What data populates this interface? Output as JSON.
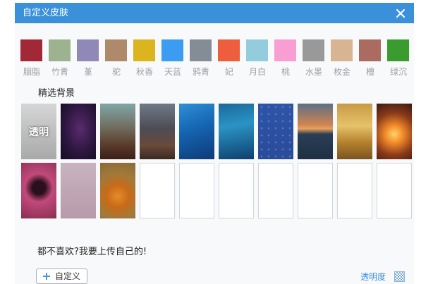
{
  "window": {
    "title": "自定义皮肤",
    "close_icon": "close-icon"
  },
  "colors": [
    {
      "label": "胭脂",
      "color": "#a02837"
    },
    {
      "label": "竹青",
      "color": "#9db38f"
    },
    {
      "label": "堇",
      "color": "#9089b8"
    },
    {
      "label": "驼",
      "color": "#ae8a6a"
    },
    {
      "label": "秋香",
      "color": "#dbb41e"
    },
    {
      "label": "天蓝",
      "color": "#3b9cf2"
    },
    {
      "label": "鸦青",
      "color": "#848c95"
    },
    {
      "label": "妃",
      "color": "#ee5d3c"
    },
    {
      "label": "月白",
      "color": "#92ccdd"
    },
    {
      "label": "桃",
      "color": "#f99ed2"
    },
    {
      "label": "水墨",
      "color": "#999999"
    },
    {
      "label": "枚金",
      "color": "#d7b593"
    },
    {
      "label": "檀",
      "color": "#ac6b60"
    },
    {
      "label": "绿沉",
      "color": "#3a9c2e"
    }
  ],
  "backgrounds": {
    "title": "精选背景",
    "transparent_label": "透明",
    "items": [
      {
        "name": "transparent"
      },
      {
        "name": "purple-blur"
      },
      {
        "name": "teal-brown-blur"
      },
      {
        "name": "grey-orange-blur"
      },
      {
        "name": "deep-blue-gradient"
      },
      {
        "name": "ocean-blue-gradient"
      },
      {
        "name": "blue-pattern"
      },
      {
        "name": "sailboat-sunset"
      },
      {
        "name": "dolphin-sunset"
      },
      {
        "name": "couple-sunset"
      },
      {
        "name": "pink-heart"
      },
      {
        "name": "cartoon-girl"
      },
      {
        "name": "puppy-pumpkin"
      },
      {
        "name": "empty-slot"
      },
      {
        "name": "empty-slot"
      },
      {
        "name": "empty-slot"
      },
      {
        "name": "empty-slot"
      },
      {
        "name": "empty-slot"
      },
      {
        "name": "empty-slot"
      },
      {
        "name": "empty-slot"
      }
    ]
  },
  "footer": {
    "upload_text": "都不喜欢?我要上传自己的!",
    "custom_button_label": "自定义",
    "opacity_label": "透明度"
  },
  "accent_color": "#3a91d9"
}
